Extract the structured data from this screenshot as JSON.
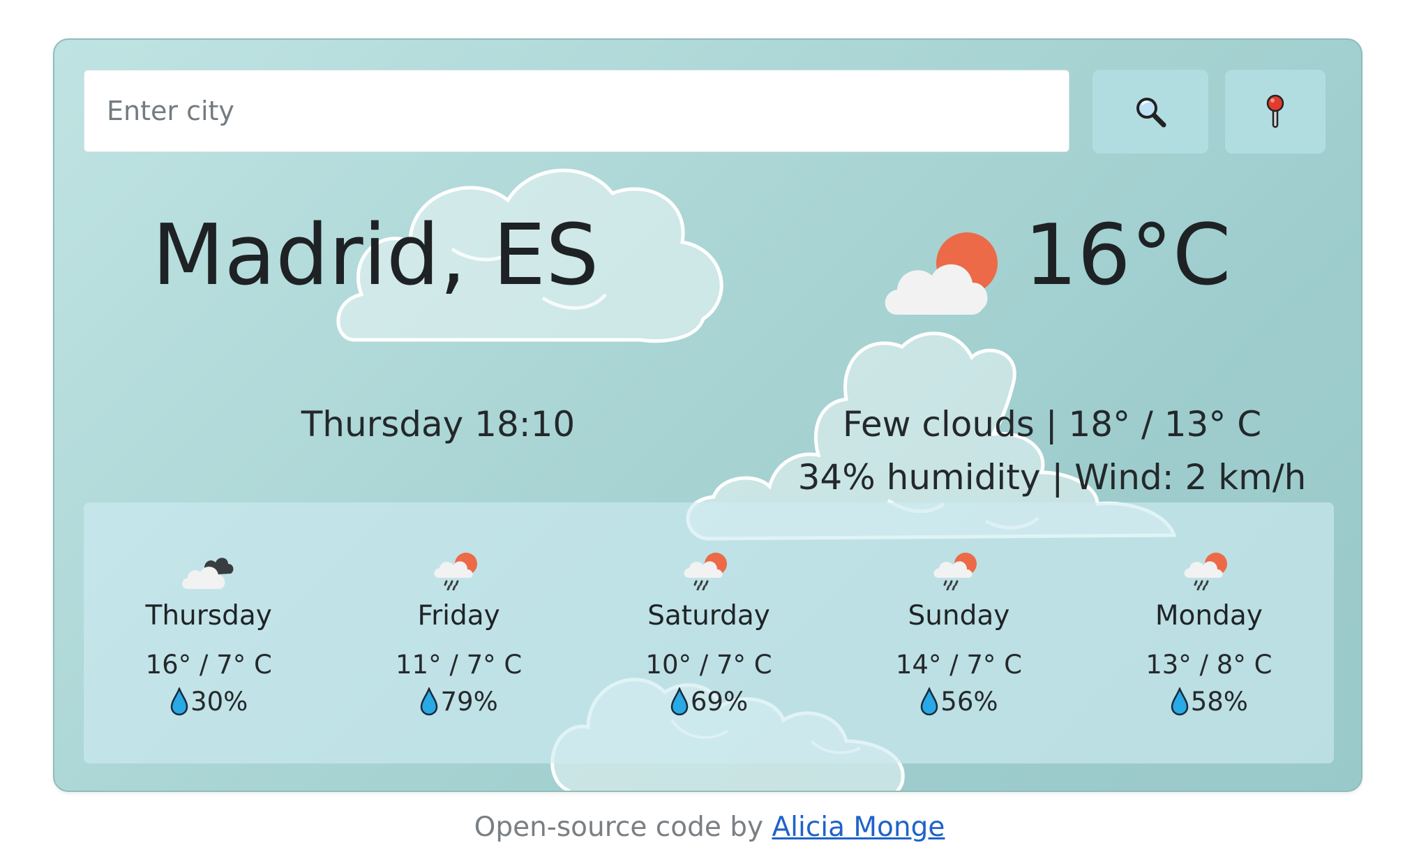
{
  "search": {
    "placeholder": "Enter city"
  },
  "buttons": {
    "search_icon": "magnifier-icon",
    "locate_icon": "pushpin-icon"
  },
  "current": {
    "city": "Madrid, ES",
    "datetime": "Thursday 18:10",
    "icon": "few-clouds-icon",
    "temperature": "16°C",
    "description": "Few clouds | 18° / 13° C",
    "details": "34% humidity | Wind: 2 km/h"
  },
  "forecast": [
    {
      "day": "Thursday",
      "range": "16° / 7° C",
      "rain": "30%",
      "icon": "broken-clouds-icon"
    },
    {
      "day": "Friday",
      "range": "11° / 7° C",
      "rain": "79%",
      "icon": "sun-rain-icon"
    },
    {
      "day": "Saturday",
      "range": "10° / 7° C",
      "rain": "69%",
      "icon": "sun-rain-icon"
    },
    {
      "day": "Sunday",
      "range": "14° / 7° C",
      "rain": "56%",
      "icon": "sun-rain-icon"
    },
    {
      "day": "Monday",
      "range": "13° / 8° C",
      "rain": "58%",
      "icon": "sun-rain-icon"
    }
  ],
  "footer": {
    "prefix": "Open-source code by ",
    "author": "Alicia Monge"
  },
  "colors": {
    "accent_sun": "#ec6a48",
    "drop": "#29a9e6",
    "link": "#1f63c9",
    "card": "#a8d4d4"
  }
}
